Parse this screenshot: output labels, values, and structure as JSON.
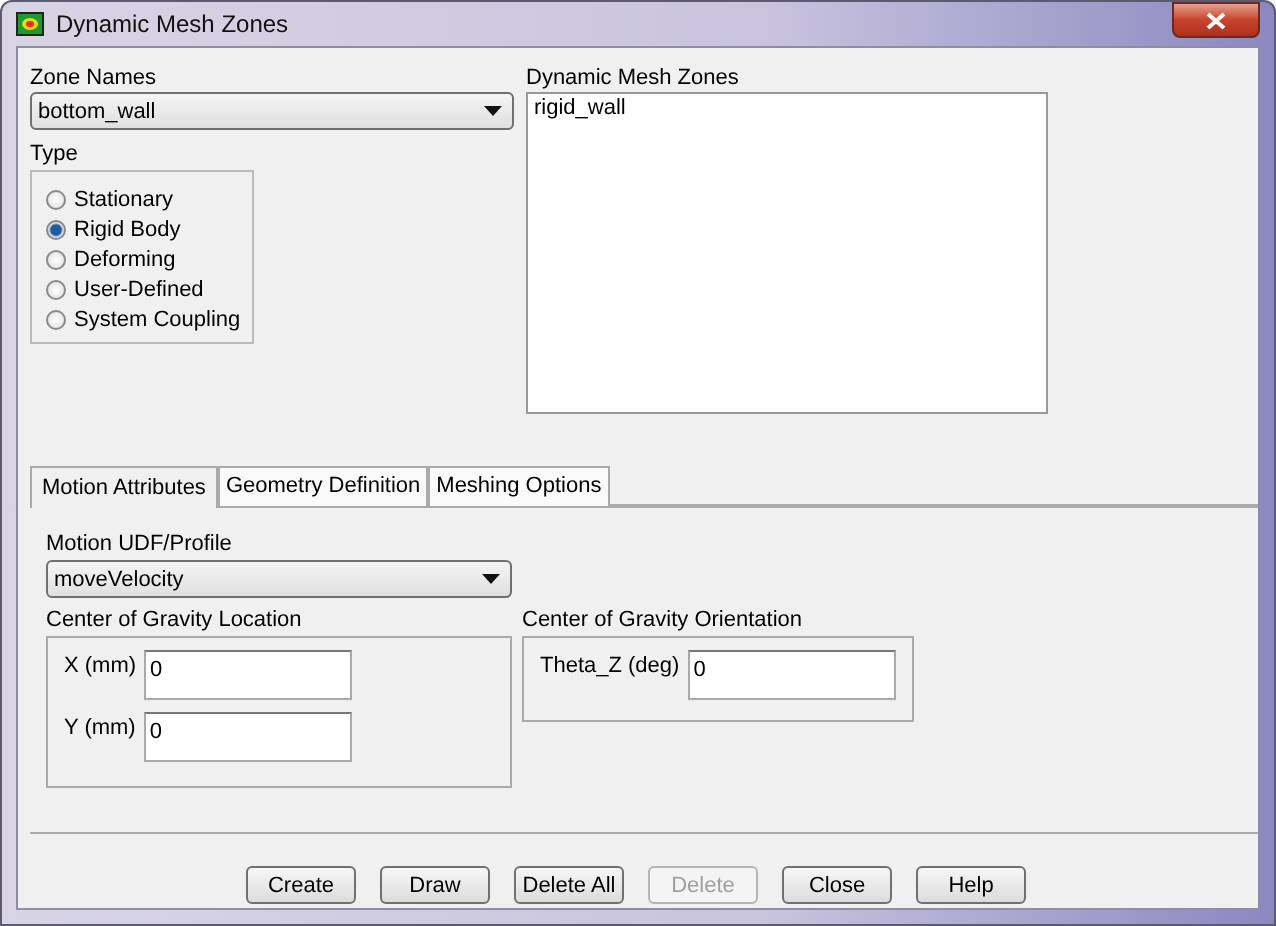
{
  "window": {
    "title": "Dynamic Mesh Zones"
  },
  "zone_names": {
    "label": "Zone Names",
    "value": "bottom_wall"
  },
  "type": {
    "label": "Type",
    "options": [
      {
        "label": "Stationary",
        "selected": false
      },
      {
        "label": "Rigid Body",
        "selected": true
      },
      {
        "label": "Deforming",
        "selected": false
      },
      {
        "label": "User-Defined",
        "selected": false
      },
      {
        "label": "System Coupling",
        "selected": false
      }
    ]
  },
  "dynamic_mesh_zones": {
    "label": "Dynamic Mesh Zones",
    "items": [
      "rigid_wall"
    ]
  },
  "tabs": [
    {
      "label": "Motion Attributes",
      "selected": true
    },
    {
      "label": "Geometry Definition",
      "selected": false
    },
    {
      "label": "Meshing Options",
      "selected": false
    }
  ],
  "motion_profile": {
    "label": "Motion UDF/Profile",
    "value": "moveVelocity"
  },
  "cog_location": {
    "label": "Center of Gravity Location",
    "fields": [
      {
        "label": "X (mm)",
        "value": "0"
      },
      {
        "label": "Y (mm)",
        "value": "0"
      }
    ]
  },
  "cog_orientation": {
    "label": "Center of Gravity Orientation",
    "fields": [
      {
        "label": "Theta_Z (deg)",
        "value": "0"
      }
    ]
  },
  "buttons": [
    {
      "label": "Create",
      "disabled": false
    },
    {
      "label": "Draw",
      "disabled": false
    },
    {
      "label": "Delete All",
      "disabled": false
    },
    {
      "label": "Delete",
      "disabled": true
    },
    {
      "label": "Close",
      "disabled": false
    },
    {
      "label": "Help",
      "disabled": false
    }
  ]
}
